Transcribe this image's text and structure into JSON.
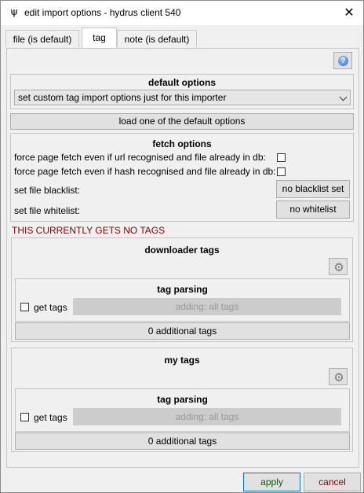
{
  "window": {
    "icon": "ψ",
    "icon_name": "hydrus-icon",
    "title": "edit import options - hydrus client 540",
    "close_glyph": "✕"
  },
  "tabs": [
    {
      "label": "file (is default)",
      "active": false
    },
    {
      "label": "tag",
      "active": true
    },
    {
      "label": "note (is default)",
      "active": false
    }
  ],
  "help": {
    "glyph": "?"
  },
  "default_options": {
    "title": "default options",
    "selected": "set custom tag import options just for this importer"
  },
  "load_default_label": "load one of the default options",
  "fetch_options": {
    "title": "fetch options",
    "force_url": "force page fetch even if url recognised and file already in db:",
    "force_hash": "force page fetch even if hash recognised and file already in db:",
    "blacklist_label": "set file blacklist:",
    "blacklist_button": "no blacklist set",
    "whitelist_label": "set file whitelist:",
    "whitelist_button": "no whitelist"
  },
  "warning": "THIS CURRENTLY GETS NO TAGS",
  "downloader_tags": {
    "title": "downloader tags",
    "parsing_title": "tag parsing",
    "get_tags_label": "get tags",
    "field": "adding: all tags",
    "additional": "0 additional tags"
  },
  "my_tags": {
    "title": "my tags",
    "parsing_title": "tag parsing",
    "get_tags_label": "get tags",
    "field": "adding: all tags",
    "additional": "0 additional tags"
  },
  "footer": {
    "apply": "apply",
    "cancel": "cancel",
    "apply_color": "#006400",
    "cancel_color": "#8b0000"
  }
}
